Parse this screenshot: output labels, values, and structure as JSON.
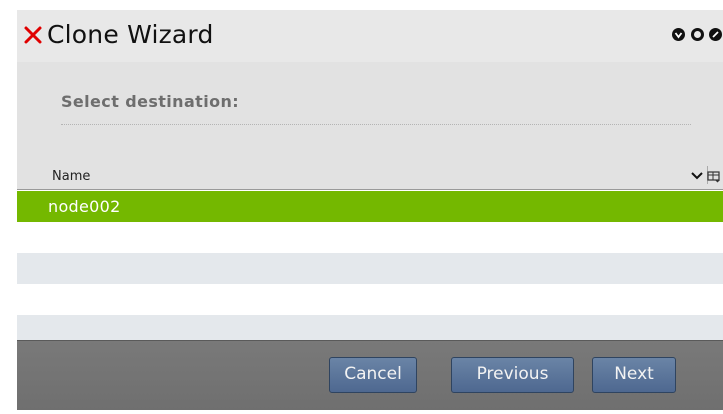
{
  "window": {
    "title": "Clone Wizard",
    "logo_icon": "red-x-logo-icon",
    "controls": [
      "minimize-circle-icon",
      "maximize-circle-icon",
      "close-circle-icon"
    ]
  },
  "step": {
    "heading": "Select destination:"
  },
  "grid": {
    "columns": [
      {
        "label": "Name",
        "sort": "descending"
      }
    ],
    "rows": [
      {
        "name": "node002",
        "selected": true
      },
      {
        "name": ""
      },
      {
        "name": ""
      },
      {
        "name": ""
      },
      {
        "name": ""
      }
    ],
    "header_icons": [
      "chevron-down-icon",
      "column-chooser-icon"
    ]
  },
  "footer": {
    "cancel_label": "Cancel",
    "previous_label": "Previous",
    "next_label": "Next"
  },
  "colors": {
    "selected_row": "#74b800",
    "button": "#5b7399",
    "footer": "#747474",
    "logo": "#e00000"
  }
}
